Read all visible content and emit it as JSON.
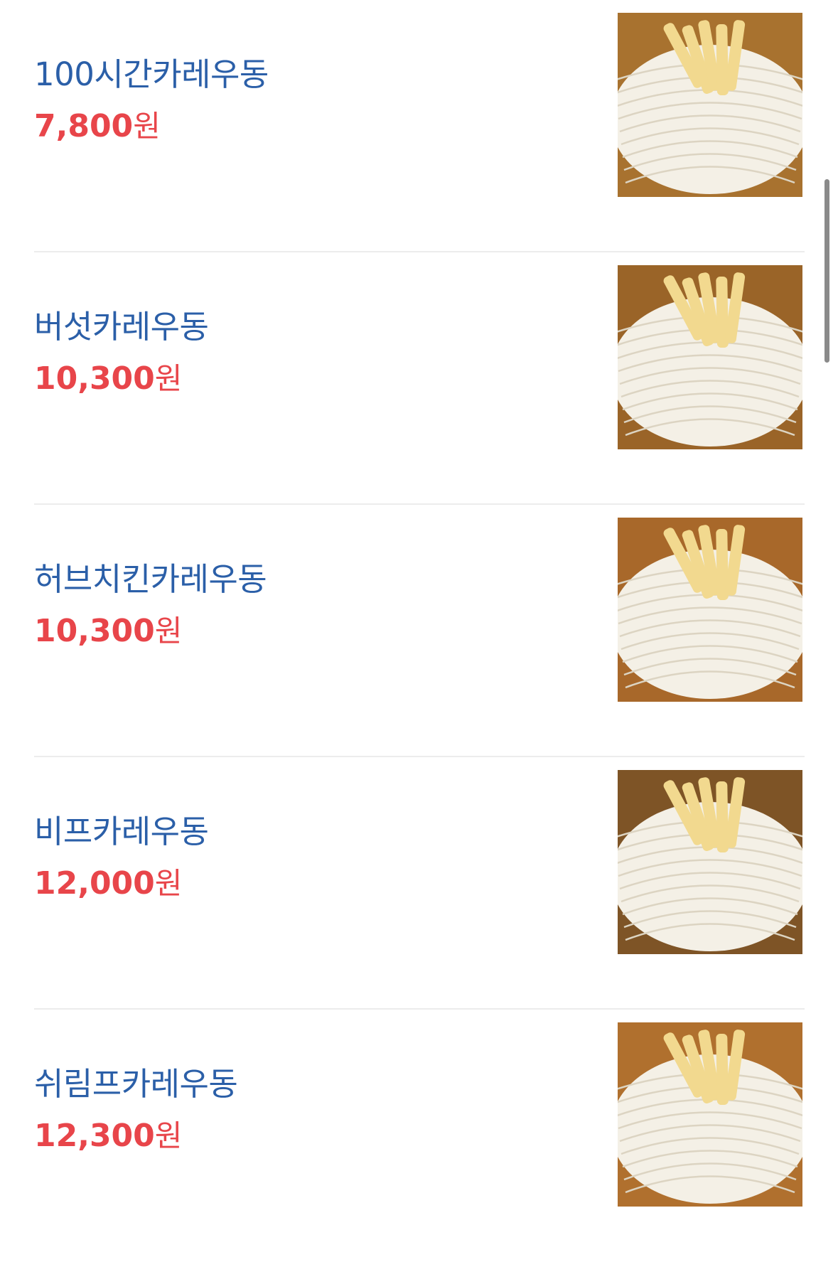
{
  "menu": {
    "items": [
      {
        "name": "100시간카레우동",
        "price": "7,800",
        "currency": "원",
        "image": "curry-udon-classic",
        "sauce_color": "#a8722f"
      },
      {
        "name": "버섯카레우동",
        "price": "10,300",
        "currency": "원",
        "image": "curry-udon-mushroom",
        "sauce_color": "#9a6428"
      },
      {
        "name": "허브치킨카레우동",
        "price": "10,300",
        "currency": "원",
        "image": "curry-udon-herb-chicken",
        "sauce_color": "#a8682a"
      },
      {
        "name": "비프카레우동",
        "price": "12,000",
        "currency": "원",
        "image": "curry-udon-beef",
        "sauce_color": "#7e5426"
      },
      {
        "name": "쉬림프카레우동",
        "price": "12,300",
        "currency": "원",
        "image": "curry-udon-shrimp",
        "sauce_color": "#b0702e"
      }
    ]
  },
  "colors": {
    "name": "#2b5fa8",
    "price": "#e8454a",
    "divider": "#ececec",
    "noodle": "#f4f0e6",
    "topping": "#f2d98f"
  }
}
